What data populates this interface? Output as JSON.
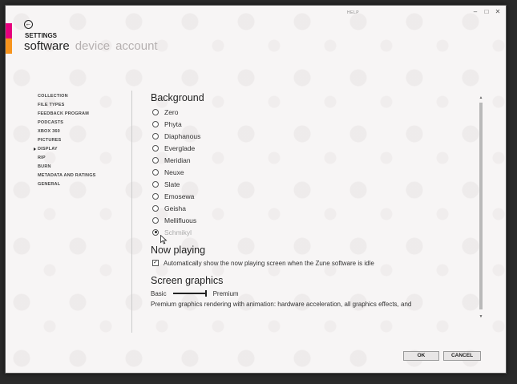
{
  "topbar": {
    "help": "HELP"
  },
  "window_controls": [
    "–",
    "□",
    "✕"
  ],
  "header": {
    "back_glyph": "←",
    "title": "SETTINGS",
    "pivots": [
      {
        "label": "software",
        "active": true
      },
      {
        "label": "device",
        "active": false
      },
      {
        "label": "account",
        "active": false
      }
    ]
  },
  "sidebar": {
    "items": [
      {
        "label": "COLLECTION",
        "selected": false
      },
      {
        "label": "FILE TYPES",
        "selected": false
      },
      {
        "label": "FEEDBACK PROGRAM",
        "selected": false
      },
      {
        "label": "PODCASTS",
        "selected": false
      },
      {
        "label": "XBOX 360",
        "selected": false
      },
      {
        "label": "PICTURES",
        "selected": false
      },
      {
        "label": "DISPLAY",
        "selected": true
      },
      {
        "label": "RIP",
        "selected": false
      },
      {
        "label": "BURN",
        "selected": false
      },
      {
        "label": "METADATA AND RATINGS",
        "selected": false
      },
      {
        "label": "GENERAL",
        "selected": false
      }
    ]
  },
  "background": {
    "heading": "Background",
    "options": [
      {
        "label": "Zero",
        "checked": false
      },
      {
        "label": "Phyta",
        "checked": false
      },
      {
        "label": "Diaphanous",
        "checked": false
      },
      {
        "label": "Everglade",
        "checked": false
      },
      {
        "label": "Meridian",
        "checked": false
      },
      {
        "label": "Neuxe",
        "checked": false
      },
      {
        "label": "Slate",
        "checked": false
      },
      {
        "label": "Emosewa",
        "checked": false
      },
      {
        "label": "Geisha",
        "checked": false
      },
      {
        "label": "Mellifluous",
        "checked": false
      },
      {
        "label": "Schmikyl",
        "checked": true
      }
    ]
  },
  "now_playing": {
    "heading": "Now playing",
    "checkbox_label": "Automatically show the now playing screen when the Zune software is idle",
    "checked": true,
    "check_glyph": "✓"
  },
  "screen_graphics": {
    "heading": "Screen graphics",
    "min_label": "Basic",
    "max_label": "Premium",
    "level": 1.0,
    "description": "Premium graphics rendering with animation: hardware acceleration, all graphics effects, and"
  },
  "scrollbar": {
    "up_glyph": "▲",
    "down_glyph": "▼"
  },
  "footer": {
    "ok_label": "OK",
    "cancel_label": "CANCEL"
  },
  "colors": {
    "accent_magenta": "#e6007e",
    "accent_orange": "#f7941d"
  }
}
